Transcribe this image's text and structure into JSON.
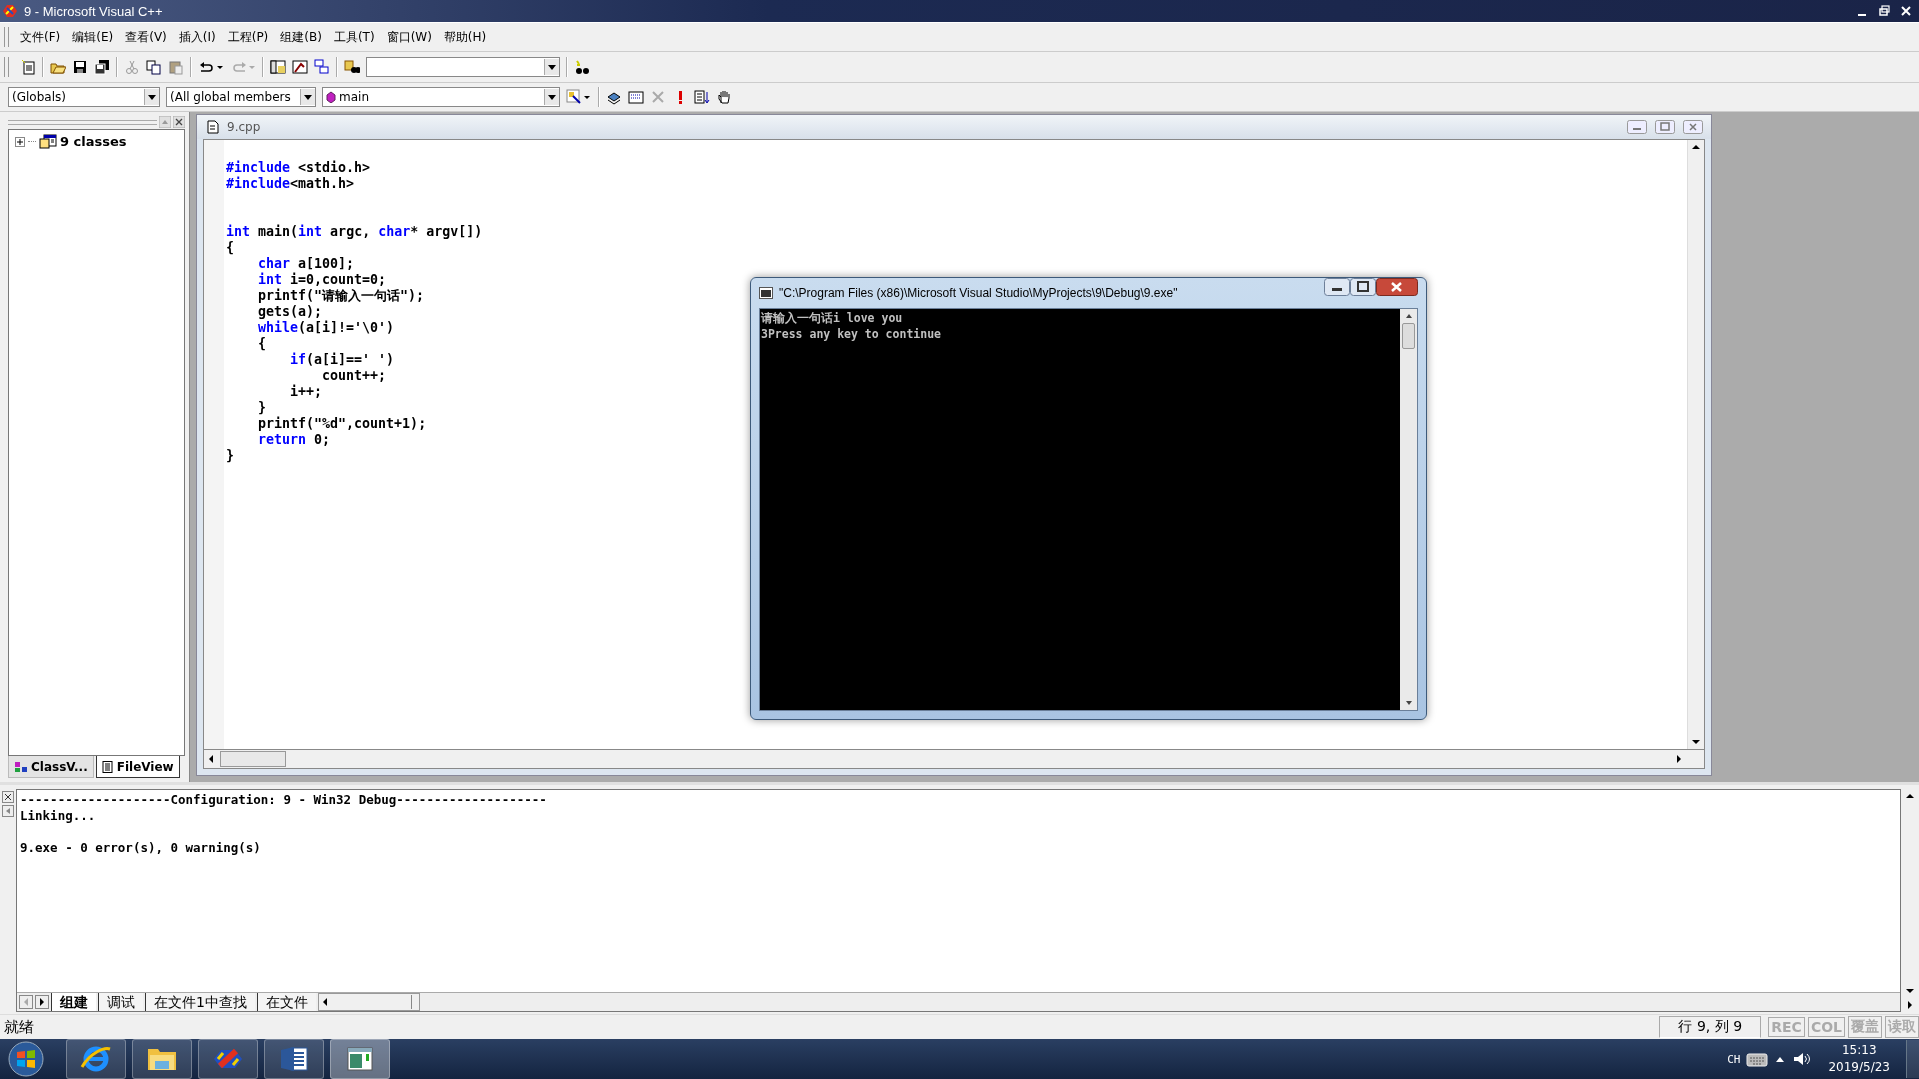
{
  "window": {
    "title": "9 - Microsoft Visual C++"
  },
  "menu": [
    "文件(F)",
    "编辑(E)",
    "查看(V)",
    "插入(I)",
    "工程(P)",
    "组建(B)",
    "工具(T)",
    "窗口(W)",
    "帮助(H)"
  ],
  "wizard_bar": {
    "scope": "(Globals)",
    "members": "(All global members",
    "function": "main"
  },
  "sidebar": {
    "tree": [
      {
        "label": "9 classes",
        "expanded": false
      }
    ],
    "tabs": [
      {
        "label": "ClassV...",
        "selected": false
      },
      {
        "label": "FileView",
        "selected": true
      }
    ]
  },
  "editor": {
    "title": "9.cpp",
    "lines": [
      {
        "kind": "code",
        "tokens": [
          {
            "text": "#include",
            "keyword": true
          },
          {
            "text": " <stdio.h>",
            "keyword": false
          }
        ]
      },
      {
        "kind": "code",
        "tokens": [
          {
            "text": "#include",
            "keyword": true
          },
          {
            "text": "<math.h>",
            "keyword": false
          }
        ]
      },
      {
        "kind": "blank"
      },
      {
        "kind": "blank"
      },
      {
        "kind": "code",
        "tokens": [
          {
            "text": "int",
            "keyword": true
          },
          {
            "text": " main(",
            "keyword": false
          },
          {
            "text": "int",
            "keyword": true
          },
          {
            "text": " argc, ",
            "keyword": false
          },
          {
            "text": "char",
            "keyword": true
          },
          {
            "text": "* argv[])",
            "keyword": false
          }
        ]
      },
      {
        "kind": "code",
        "tokens": [
          {
            "text": "{",
            "keyword": false
          }
        ]
      },
      {
        "kind": "code",
        "tokens": [
          {
            "text": "    char",
            "keyword": true
          },
          {
            "text": " a[100];",
            "keyword": false
          }
        ]
      },
      {
        "kind": "code",
        "tokens": [
          {
            "text": "    int",
            "keyword": true
          },
          {
            "text": " i=0,count=0;",
            "keyword": false
          }
        ]
      },
      {
        "kind": "code",
        "tokens": [
          {
            "text": "    printf(\"请输入一句话\");",
            "keyword": false
          }
        ]
      },
      {
        "kind": "code",
        "tokens": [
          {
            "text": "    gets(a);",
            "keyword": false
          }
        ]
      },
      {
        "kind": "code",
        "tokens": [
          {
            "text": "    while",
            "keyword": true
          },
          {
            "text": "(a[i]!='\\0')",
            "keyword": false
          }
        ]
      },
      {
        "kind": "code",
        "tokens": [
          {
            "text": "    {",
            "keyword": false
          }
        ]
      },
      {
        "kind": "code",
        "tokens": [
          {
            "text": "        if",
            "keyword": true
          },
          {
            "text": "(a[i]==' ')",
            "keyword": false
          }
        ]
      },
      {
        "kind": "code",
        "tokens": [
          {
            "text": "            count++;",
            "keyword": false
          }
        ]
      },
      {
        "kind": "code",
        "tokens": [
          {
            "text": "        i++;",
            "keyword": false
          }
        ]
      },
      {
        "kind": "code",
        "tokens": [
          {
            "text": "    }",
            "keyword": false
          }
        ]
      },
      {
        "kind": "code",
        "tokens": [
          {
            "text": "    printf(\"%d\",count+1);",
            "keyword": false
          }
        ]
      },
      {
        "kind": "code",
        "tokens": [
          {
            "text": "    return",
            "keyword": true
          },
          {
            "text": " 0;",
            "keyword": false
          }
        ]
      },
      {
        "kind": "code",
        "tokens": [
          {
            "text": "}",
            "keyword": false
          }
        ]
      }
    ]
  },
  "console": {
    "title": "\"C:\\Program Files (x86)\\Microsoft Visual Studio\\MyProjects\\9\\Debug\\9.exe\"",
    "lines": [
      "请输入一句话i love you",
      "3Press any key to continue"
    ]
  },
  "output": {
    "lines": [
      {
        "kind": "text",
        "text": "--------------------Configuration: 9 - Win32 Debug--------------------"
      },
      {
        "kind": "text",
        "text": "Linking..."
      },
      {
        "kind": "blank"
      },
      {
        "kind": "text",
        "text": "9.exe - 0 error(s), 0 warning(s)"
      }
    ],
    "tabs": [
      {
        "label": "组建",
        "selected": true
      },
      {
        "label": "调试",
        "selected": false
      },
      {
        "label": "在文件1中查找",
        "selected": false
      },
      {
        "label": "在文件",
        "selected": false
      }
    ]
  },
  "status_bar": {
    "text": "就绪",
    "position": "行 9, 列 9",
    "indicators": [
      {
        "label": "REC",
        "disabled": true
      },
      {
        "label": "COL",
        "disabled": true
      },
      {
        "label": "覆盖",
        "disabled": true
      },
      {
        "label": "读取",
        "disabled": true
      }
    ]
  },
  "taskbar": {
    "apps": [
      {
        "kind": "browser",
        "active": false
      },
      {
        "kind": "folder",
        "active": false
      },
      {
        "kind": "ide",
        "active": false
      },
      {
        "kind": "word",
        "active": false
      },
      {
        "kind": "console",
        "active": true
      }
    ],
    "tray": {
      "language": "CH",
      "time": "15:13",
      "date": "2019/5/23"
    }
  }
}
